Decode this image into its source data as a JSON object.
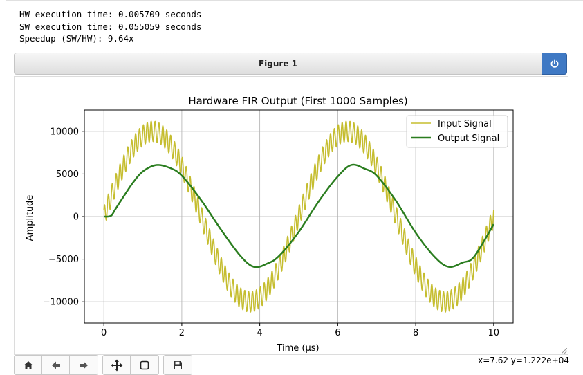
{
  "console": {
    "lines": [
      "HW execution time: 0.005709 seconds",
      "SW execution time: 0.055059 seconds",
      "Speedup (SW/HW): 9.64x"
    ]
  },
  "figure": {
    "title": "Figure 1",
    "power_icon": "power-icon"
  },
  "toolbar": {
    "icons": [
      "home-icon",
      "back-arrow-icon",
      "forward-arrow-icon",
      "move-icon",
      "zoom-rect-icon",
      "save-icon"
    ]
  },
  "status": {
    "coords": "x=7.62 y=1.222e+04"
  },
  "colors": {
    "input_signal": "#c5bd2f",
    "output_signal": "#2a7d1f",
    "power_button": "#3f79c4"
  },
  "chart_data": {
    "type": "line",
    "title": "Hardware FIR Output (First 1000 Samples)",
    "xlabel": "Time (μs)",
    "ylabel": "Amplitude",
    "xlim": [
      -0.5,
      10.5
    ],
    "ylim": [
      -12500,
      12500
    ],
    "xticks": [
      0,
      2,
      4,
      6,
      8,
      10
    ],
    "xtick_labels": [
      "0",
      "2",
      "4",
      "6",
      "8",
      "10"
    ],
    "yticks": [
      -10000,
      -5000,
      0,
      5000,
      10000
    ],
    "ytick_labels": [
      "−10000",
      "−5000",
      "0",
      "5000",
      "10000"
    ],
    "grid": true,
    "legend_position": "top-right",
    "series": [
      {
        "name": "Input Signal",
        "kind": "noisy-sine",
        "x_start": 0,
        "x_end": 10,
        "base_amplitude": 10000,
        "base_period": 5,
        "ripple_amplitude": 1200,
        "ripple_period": 0.1
      },
      {
        "name": "Output Signal",
        "x": [
          0,
          0.1,
          0.2,
          0.3,
          0.5,
          0.75,
          1.0,
          1.35,
          1.7,
          2.0,
          2.5,
          3.0,
          3.5,
          3.85,
          4.2,
          4.5,
          5.0,
          5.5,
          6.0,
          6.35,
          6.7,
          7.0,
          7.5,
          8.0,
          8.5,
          8.85,
          9.2,
          9.5,
          10.0
        ],
        "y": [
          0,
          0,
          150,
          900,
          2300,
          4000,
          5300,
          6050,
          5700,
          4800,
          1900,
          -1500,
          -4600,
          -5900,
          -5500,
          -4600,
          -1800,
          1700,
          4700,
          6050,
          5600,
          4800,
          1800,
          -1900,
          -4800,
          -5900,
          -5400,
          -4700,
          -900
        ]
      }
    ]
  }
}
